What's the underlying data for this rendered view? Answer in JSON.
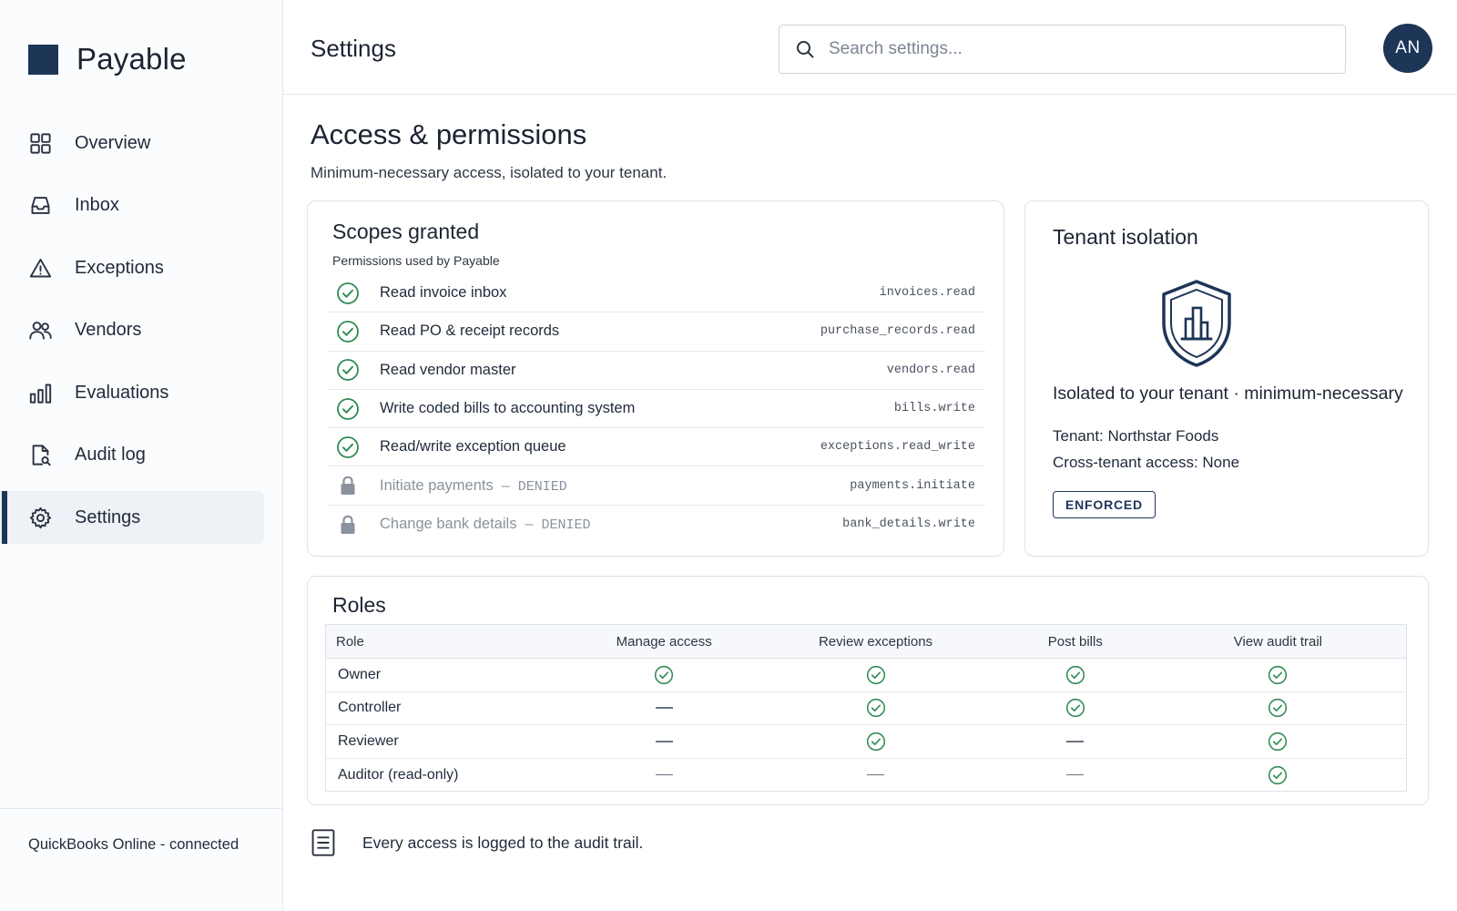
{
  "app": {
    "name": "Payable"
  },
  "colors": {
    "brand": "#1d3557",
    "success": "#2f8a52",
    "muted": "#8a929e"
  },
  "sidebar": {
    "items": [
      {
        "label": "Overview",
        "icon": "grid-icon",
        "active": false
      },
      {
        "label": "Inbox",
        "icon": "inbox-icon",
        "active": false
      },
      {
        "label": "Exceptions",
        "icon": "warning-icon",
        "active": false
      },
      {
        "label": "Vendors",
        "icon": "users-icon",
        "active": false
      },
      {
        "label": "Evaluations",
        "icon": "bar-chart-icon",
        "active": false
      },
      {
        "label": "Audit log",
        "icon": "file-search-icon",
        "active": false
      },
      {
        "label": "Settings",
        "icon": "gear-icon",
        "active": true
      }
    ],
    "footer": "QuickBooks Online - connected"
  },
  "header": {
    "title": "Settings",
    "search_placeholder": "Search settings...",
    "avatar_initials": "AN"
  },
  "section": {
    "title": "Access & permissions",
    "subtitle": "Minimum-necessary access, isolated to your tenant."
  },
  "scopes": {
    "title": "Scopes granted",
    "subtitle": "Permissions used by Payable",
    "items": [
      {
        "label": "Read invoice inbox",
        "code": "invoices.read",
        "status": "granted"
      },
      {
        "label": "Read PO & receipt records",
        "code": "purchase_records.read",
        "status": "granted"
      },
      {
        "label": "Read vendor master",
        "code": "vendors.read",
        "status": "granted"
      },
      {
        "label": "Write coded bills to accounting system",
        "code": "bills.write",
        "status": "granted"
      },
      {
        "label": "Read/write exception queue",
        "code": "exceptions.read_write",
        "status": "granted"
      },
      {
        "label": "Initiate payments",
        "code": "payments.initiate",
        "status": "denied",
        "denied_text": " — DENIED"
      },
      {
        "label": "Change bank details",
        "code": "bank_details.write",
        "status": "denied",
        "denied_text": " — DENIED"
      }
    ]
  },
  "tenant": {
    "title": "Tenant isolation",
    "headline": "Isolated to your tenant · minimum-necessary",
    "tenant_line": "Tenant: Northstar Foods",
    "cross_line": "Cross-tenant access: None",
    "badge": "ENFORCED"
  },
  "roles": {
    "title": "Roles",
    "columns": [
      "Role",
      "Manage access",
      "Review exceptions",
      "Post bills",
      "View audit trail"
    ],
    "rows": [
      {
        "role": "Owner",
        "perms": [
          true,
          true,
          true,
          true
        ]
      },
      {
        "role": "Controller",
        "perms": [
          false,
          true,
          true,
          true
        ]
      },
      {
        "role": "Reviewer",
        "perms": [
          false,
          true,
          false,
          true
        ]
      },
      {
        "role": "Auditor (read-only)",
        "perms": [
          false,
          false,
          false,
          true
        ]
      }
    ]
  },
  "footer_note": "Every access is logged to the audit trail."
}
